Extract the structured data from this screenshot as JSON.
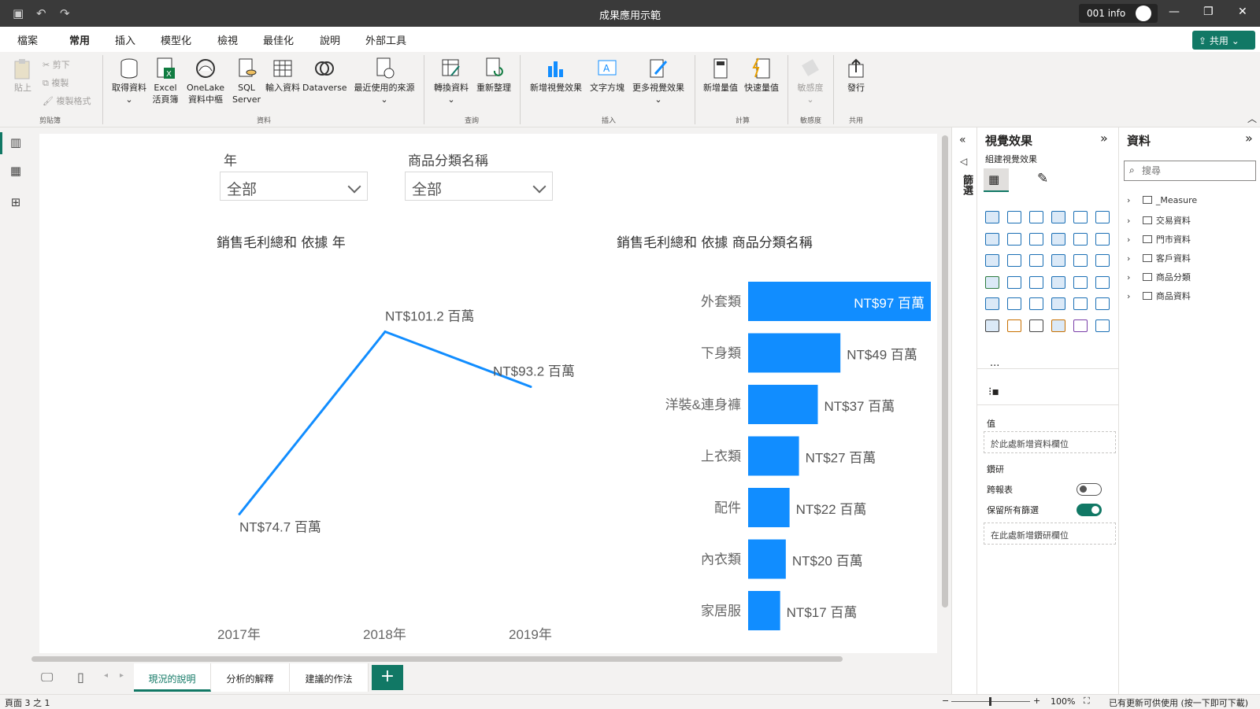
{
  "window": {
    "title": "成果應用示範",
    "account": "001 info"
  },
  "tabs": [
    "檔案",
    "常用",
    "插入",
    "模型化",
    "檢視",
    "最佳化",
    "說明",
    "外部工具"
  ],
  "share_label": "共用",
  "ribbon": {
    "paste": "貼上",
    "cut": "剪下",
    "copy": "複製",
    "format_painter": "複製格式",
    "get_data": "取得資料",
    "excel": "Excel 活頁簿",
    "onelake": "OneLake 資料中樞",
    "sql": "SQL Server",
    "enter_data": "輸入資料",
    "dataverse": "Dataverse",
    "recent": "最近使用的來源",
    "transform": "轉換資料",
    "refresh": "重新整理",
    "new_visual": "新增視覺效果",
    "text_box": "文字方塊",
    "more_visuals": "更多視覺效果",
    "new_measure": "新增量值",
    "quick_measure": "快速量值",
    "sensitivity": "敏感度",
    "publish": "發行",
    "groups": [
      "剪貼簿",
      "資料",
      "查詢",
      "插入",
      "計算",
      "敏感度",
      "共用"
    ]
  },
  "slicers": [
    {
      "label": "年",
      "value": "全部"
    },
    {
      "label": "商品分類名稱",
      "value": "全部"
    }
  ],
  "charts": {
    "line_title": "銷售毛利總和 依據 年",
    "bar_title": "銷售毛利總和 依據 商品分類名稱"
  },
  "chart_data": [
    {
      "type": "line",
      "title": "銷售毛利總和 依據 年",
      "x": [
        "2017年",
        "2018年",
        "2019年"
      ],
      "values": [
        74.7,
        101.2,
        93.2
      ],
      "labels": [
        "NT$74.7 百萬",
        "NT$101.2 百萬",
        "NT$93.2 百萬"
      ],
      "color": "#118DFF"
    },
    {
      "type": "bar",
      "title": "銷售毛利總和 依據 商品分類名稱",
      "categories": [
        "外套類",
        "下身類",
        "洋裝&連身褲",
        "上衣類",
        "配件",
        "內衣類",
        "家居服"
      ],
      "values": [
        97,
        49,
        37,
        27,
        22,
        20,
        17
      ],
      "labels": [
        "NT$97 百萬",
        "NT$49 百萬",
        "NT$37 百萬",
        "NT$27 百萬",
        "NT$22 百萬",
        "NT$20 百萬",
        "NT$17 百萬"
      ],
      "color": "#118DFF"
    }
  ],
  "pages": [
    "現況的說明",
    "分析的解釋",
    "建議的作法"
  ],
  "status": {
    "page": "頁面 3 之 1",
    "zoom": "100%",
    "update": "已有更新可供使用 (按一下即可下載)"
  },
  "filters_label": "篩選",
  "viz_pane": {
    "title": "視覺效果",
    "subtitle": "組建視覺效果",
    "values_label": "值",
    "values_field": "於此處新增資料欄位",
    "drill_label": "鑽研",
    "cross_report": "跨報表",
    "keep_filters": "保留所有篩選",
    "drill_field": "在此處新增鑽研欄位",
    "more": "..."
  },
  "data_pane": {
    "title": "資料",
    "search_placeholder": "搜尋",
    "tables": [
      "_Measure",
      "交易資料",
      "門市資料",
      "客戶資料",
      "商品分類",
      "商品資料"
    ]
  }
}
